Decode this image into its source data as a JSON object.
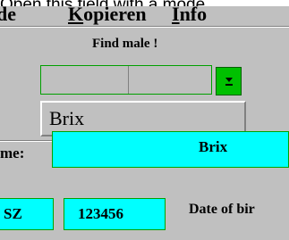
{
  "window": {
    "caption": "Open this field with a mode"
  },
  "menubar": {
    "items": [
      {
        "pre": "",
        "accel": "",
        "post": "de"
      },
      {
        "pre": "",
        "accel": "K",
        "post": "opieren"
      },
      {
        "pre": "",
        "accel": "I",
        "post": "nfo"
      }
    ]
  },
  "search": {
    "label": "Find male !",
    "selected_value": "",
    "options": [
      "Brix"
    ]
  },
  "icons": {
    "dropdown": "dropdown-arrow-icon"
  },
  "record": {
    "name_label": "me:",
    "name_value": "Brix",
    "code_value": "SZ",
    "id_value": "123456",
    "dob_label": "Date of bir"
  },
  "colors": {
    "field_bg": "#00ffff",
    "button_bg": "#00c000",
    "border": "#00a000"
  }
}
